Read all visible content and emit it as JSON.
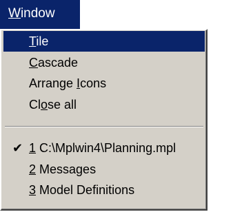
{
  "menu_title": {
    "label": "Window",
    "access_key": "W"
  },
  "colors": {
    "highlight": "#0a246a",
    "menu_face": "#d4d0c8",
    "highlight_text": "#ffffff"
  },
  "menu_items": [
    {
      "id": "tile",
      "label": "Tile",
      "access_key": "T",
      "highlighted": true
    },
    {
      "id": "cascade",
      "label": "Cascade",
      "access_key": "C"
    },
    {
      "id": "arrange-icons",
      "label": "Arrange Icons",
      "access_key": "I"
    },
    {
      "id": "close-all",
      "label": "Close all",
      "access_key": "o"
    }
  ],
  "window_list": [
    {
      "number": "1",
      "label": "C:\\Mplwin4\\Planning.mpl",
      "checked": true,
      "check_glyph": "✔"
    },
    {
      "number": "2",
      "label": "Messages",
      "checked": false
    },
    {
      "number": "3",
      "label": "Model Definitions",
      "checked": false
    }
  ]
}
